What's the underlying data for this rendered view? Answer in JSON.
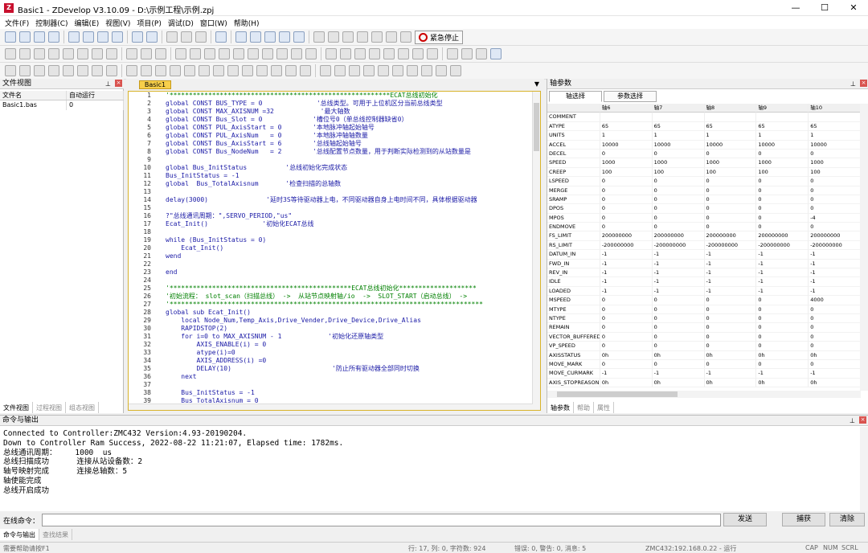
{
  "window": {
    "title": "Basic1 - ZDevelop V3.10.09 - D:\\示例工程\\示例.zpj",
    "minimize": "—",
    "maximize": "☐",
    "close": "✕"
  },
  "menu": [
    "文件(F)",
    "控制器(C)",
    "编辑(E)",
    "视图(V)",
    "项目(P)",
    "调试(D)",
    "窗口(W)",
    "帮助(H)"
  ],
  "toolbar": {
    "estop_label": "紧急停止"
  },
  "file_view": {
    "title": "文件视图",
    "columns": [
      "文件名",
      "自动运行"
    ],
    "rows": [
      [
        "Basic1.bas",
        "0"
      ]
    ],
    "tabs": [
      "文件视图",
      "过程视图",
      "组态视图"
    ]
  },
  "editor": {
    "tab": "Basic1",
    "lines": [
      {
        "n": "1",
        "t": "'*********************************************************ECAT总线初始化"
      },
      {
        "n": "2",
        "t": "global CONST BUS_TYPE = 0              '总线类型。可用于上位机区分当前总线类型"
      },
      {
        "n": "3",
        "t": "global CONST MAX_AXISNUM =32            '最大轴数"
      },
      {
        "n": "4",
        "t": "global CONST Bus_Slot = 0             '槽位号0（单总线控制器缺省0）"
      },
      {
        "n": "5",
        "t": "global CONST PUL_AxisStart = 0        '本地脉冲轴起始轴号"
      },
      {
        "n": "6",
        "t": "global CONST PUL_AxisNum   = 0        '本地脉冲轴轴数量"
      },
      {
        "n": "7",
        "t": "global CONST Bus_AxisStart = 6        '总线轴起始轴号"
      },
      {
        "n": "8",
        "t": "global CONST Bus_NodeNum   = 2        '总线配置节点数量，用于判断实际检测到的从站数量是"
      },
      {
        "n": "9",
        "t": ""
      },
      {
        "n": "10",
        "t": "global Bus_InitStatus          '总线初始化完成状态"
      },
      {
        "n": "11",
        "t": "Bus_InitStatus = -1"
      },
      {
        "n": "12",
        "t": "global  Bus_TotalAxisnum       '检查扫描的总轴数"
      },
      {
        "n": "13",
        "t": ""
      },
      {
        "n": "14",
        "t": "delay(3000)               '延时3S等待驱动器上电，不同驱动器自身上电时间不同，具体根据驱动器"
      },
      {
        "n": "15",
        "t": ""
      },
      {
        "n": "16",
        "t": "?\"总线通讯周期：\",SERVO_PERIOD,\"us\""
      },
      {
        "n": "17",
        "t": "Ecat_Init()              '初始化ECAT总线"
      },
      {
        "n": "18",
        "t": ""
      },
      {
        "n": "19",
        "t": "while (Bus_InitStatus = 0)"
      },
      {
        "n": "20",
        "t": "    Ecat_Init()"
      },
      {
        "n": "21",
        "t": "wend"
      },
      {
        "n": "22",
        "t": ""
      },
      {
        "n": "23",
        "t": "end"
      },
      {
        "n": "24",
        "t": ""
      },
      {
        "n": "25",
        "t": "'***********************************************ECAT总线初始化********************"
      },
      {
        "n": "26",
        "t": "'初始流程： slot_scan（扫描总线） ->  从站节点映射轴/io  ->  SLOT_START（启动总线） ->"
      },
      {
        "n": "27",
        "t": "'*********************************************************************************"
      },
      {
        "n": "28",
        "t": "global sub Ecat_Init()"
      },
      {
        "n": "29",
        "t": "    local Node_Num,Temp_Axis,Drive_Vender,Drive_Device,Drive_Alias"
      },
      {
        "n": "30",
        "t": "    RAPIDSTOP(2)"
      },
      {
        "n": "31",
        "t": "    for i=0 to MAX_AXISNUM - 1            '初始化还原轴类型"
      },
      {
        "n": "32",
        "t": "        AXIS_ENABLE(i) = 0"
      },
      {
        "n": "33",
        "t": "        atype(i)=0"
      },
      {
        "n": "34",
        "t": "        AXIS_ADDRESS(i) =0"
      },
      {
        "n": "35",
        "t": "        DELAY(10)                          '防止所有驱动器全部同时切换"
      },
      {
        "n": "36",
        "t": "    next"
      },
      {
        "n": "37",
        "t": ""
      },
      {
        "n": "38",
        "t": "    Bus_InitStatus = -1"
      },
      {
        "n": "39",
        "t": "    Bus_TotalAxisnum = 0"
      }
    ]
  },
  "axis_params": {
    "title": "轴参数",
    "btn_axis": "轴选择",
    "btn_param": "参数选择",
    "columns": [
      "",
      "轴6",
      "轴7",
      "轴8",
      "轴9",
      "轴10"
    ],
    "rows": [
      [
        "COMMENT",
        "",
        "",
        "",
        "",
        ""
      ],
      [
        "ATYPE",
        "65",
        "65",
        "65",
        "65",
        "65"
      ],
      [
        "UNITS",
        "1",
        "1",
        "1",
        "1",
        "1"
      ],
      [
        "ACCEL",
        "10000",
        "10000",
        "10000",
        "10000",
        "10000"
      ],
      [
        "DECEL",
        "0",
        "0",
        "0",
        "0",
        "0"
      ],
      [
        "SPEED",
        "1000",
        "1000",
        "1000",
        "1000",
        "1000"
      ],
      [
        "CREEP",
        "100",
        "100",
        "100",
        "100",
        "100"
      ],
      [
        "LSPEED",
        "0",
        "0",
        "0",
        "0",
        "0"
      ],
      [
        "MERGE",
        "0",
        "0",
        "0",
        "0",
        "0"
      ],
      [
        "SRAMP",
        "0",
        "0",
        "0",
        "0",
        "0"
      ],
      [
        "DPOS",
        "0",
        "0",
        "0",
        "0",
        "0"
      ],
      [
        "MPOS",
        "0",
        "0",
        "0",
        "0",
        "-4"
      ],
      [
        "ENDMOVE",
        "0",
        "0",
        "0",
        "0",
        "0"
      ],
      [
        "FS_LIMIT",
        "200000000",
        "200000000",
        "200000000",
        "200000000",
        "200000000"
      ],
      [
        "RS_LIMIT",
        "-200000000",
        "-200000000",
        "-200000000",
        "-200000000",
        "-200000000"
      ],
      [
        "DATUM_IN",
        "-1",
        "-1",
        "-1",
        "-1",
        "-1"
      ],
      [
        "FWD_IN",
        "-1",
        "-1",
        "-1",
        "-1",
        "-1"
      ],
      [
        "REV_IN",
        "-1",
        "-1",
        "-1",
        "-1",
        "-1"
      ],
      [
        "IDLE",
        "-1",
        "-1",
        "-1",
        "-1",
        "-1"
      ],
      [
        "LOADED",
        "-1",
        "-1",
        "-1",
        "-1",
        "-1"
      ],
      [
        "MSPEED",
        "0",
        "0",
        "0",
        "0",
        "4000"
      ],
      [
        "MTYPE",
        "0",
        "0",
        "0",
        "0",
        "0"
      ],
      [
        "NTYPE",
        "0",
        "0",
        "0",
        "0",
        "0"
      ],
      [
        "REMAIN",
        "0",
        "0",
        "0",
        "0",
        "0"
      ],
      [
        "VECTOR_BUFFERED",
        "0",
        "0",
        "0",
        "0",
        "0"
      ],
      [
        "VP_SPEED",
        "0",
        "0",
        "0",
        "0",
        "0"
      ],
      [
        "AXISSTATUS",
        "0h",
        "0h",
        "0h",
        "0h",
        "0h"
      ],
      [
        "MOVE_MARK",
        "0",
        "0",
        "0",
        "0",
        "0"
      ],
      [
        "MOVE_CURMARK",
        "-1",
        "-1",
        "-1",
        "-1",
        "-1"
      ],
      [
        "AXIS_STOPREASON",
        "0h",
        "0h",
        "0h",
        "0h",
        "0h"
      ]
    ],
    "tabs": [
      "轴参数",
      "帮助",
      "属性"
    ]
  },
  "output": {
    "title": "命令与输出",
    "lines": [
      "Connected to Controller:ZMC432 Version:4.93-20190204.",
      "Down to Controller Ram Success, 2022-08-22 11:21:07, Elapsed time: 1782ms.",
      "总线通讯周期：    1000  us",
      "总线扫描成功      连接从站设备数：2",
      "轴号映射完成      连接总轴数：5",
      "轴使能完成",
      "总线开启成功"
    ]
  },
  "command": {
    "label": "在线命令：",
    "send": "发送",
    "capture": "捕获",
    "clear": "清除"
  },
  "bottom_tabs": [
    "命令与输出",
    "查找结果"
  ],
  "status": {
    "help": "需要帮助请按F1",
    "pos": "行: 17, 列: 0, 字符数: 924",
    "errors": "错误: 0, 警告: 0, 消息: 5",
    "conn": "ZMC432:192.168.0.22 - 运行",
    "caps": "CAP",
    "num": "NUM",
    "scrl": "SCRL"
  }
}
